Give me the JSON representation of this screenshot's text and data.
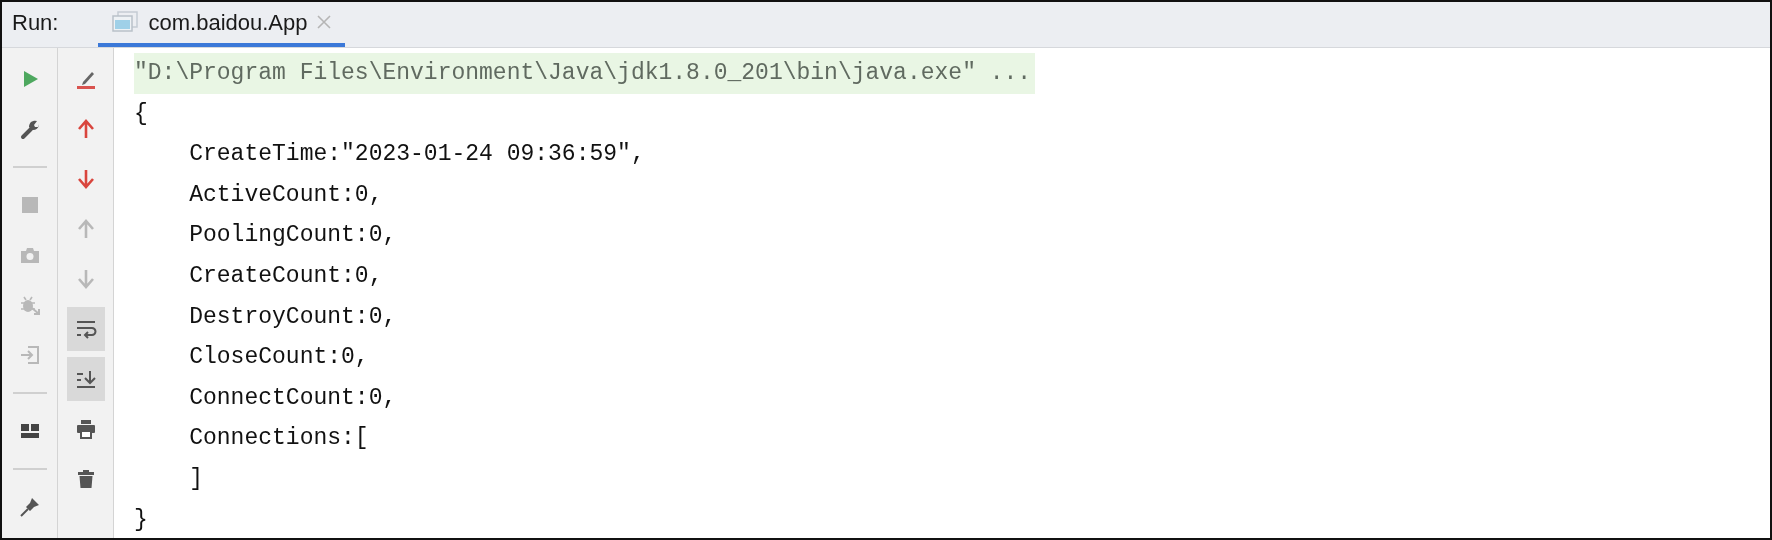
{
  "header": {
    "label": "Run:",
    "tabs": [
      {
        "title": "com.baidou.App",
        "selected": true
      }
    ]
  },
  "toolbar_1": [
    {
      "kind": "run",
      "disabled": false
    },
    {
      "kind": "wrench",
      "disabled": false
    },
    {
      "kind": "separator"
    },
    {
      "kind": "stop",
      "disabled": true
    },
    {
      "kind": "camera",
      "disabled": true
    },
    {
      "kind": "bug",
      "disabled": true
    },
    {
      "kind": "enter",
      "disabled": true
    },
    {
      "kind": "separator"
    },
    {
      "kind": "layout",
      "disabled": false
    },
    {
      "kind": "separator"
    },
    {
      "kind": "pin",
      "disabled": false
    }
  ],
  "toolbar_2": [
    {
      "kind": "clear",
      "disabled": false,
      "selected": false
    },
    {
      "kind": "up",
      "disabled": false,
      "selected": false
    },
    {
      "kind": "down",
      "disabled": false,
      "selected": false
    },
    {
      "kind": "up",
      "disabled": true,
      "selected": false
    },
    {
      "kind": "down",
      "disabled": true,
      "selected": false
    },
    {
      "kind": "wrap",
      "disabled": false,
      "selected": true
    },
    {
      "kind": "scroll_end",
      "disabled": false,
      "selected": true
    },
    {
      "kind": "print",
      "disabled": false,
      "selected": false
    },
    {
      "kind": "trash",
      "disabled": false,
      "selected": false
    }
  ],
  "console": [
    {
      "kind": "command",
      "text": "\"D:\\Program Files\\Environment\\Java\\jdk1.8.0_201\\bin\\java.exe\" ..."
    },
    {
      "kind": "output",
      "text": "{"
    },
    {
      "kind": "output",
      "text": "    CreateTime:\"2023-01-24 09:36:59\","
    },
    {
      "kind": "output",
      "text": "    ActiveCount:0,"
    },
    {
      "kind": "output",
      "text": "    PoolingCount:0,"
    },
    {
      "kind": "output",
      "text": "    CreateCount:0,"
    },
    {
      "kind": "output",
      "text": "    DestroyCount:0,"
    },
    {
      "kind": "output",
      "text": "    CloseCount:0,"
    },
    {
      "kind": "output",
      "text": "    ConnectCount:0,"
    },
    {
      "kind": "output",
      "text": "    Connections:["
    },
    {
      "kind": "output",
      "text": "    ]"
    },
    {
      "kind": "output",
      "text": "}"
    }
  ]
}
